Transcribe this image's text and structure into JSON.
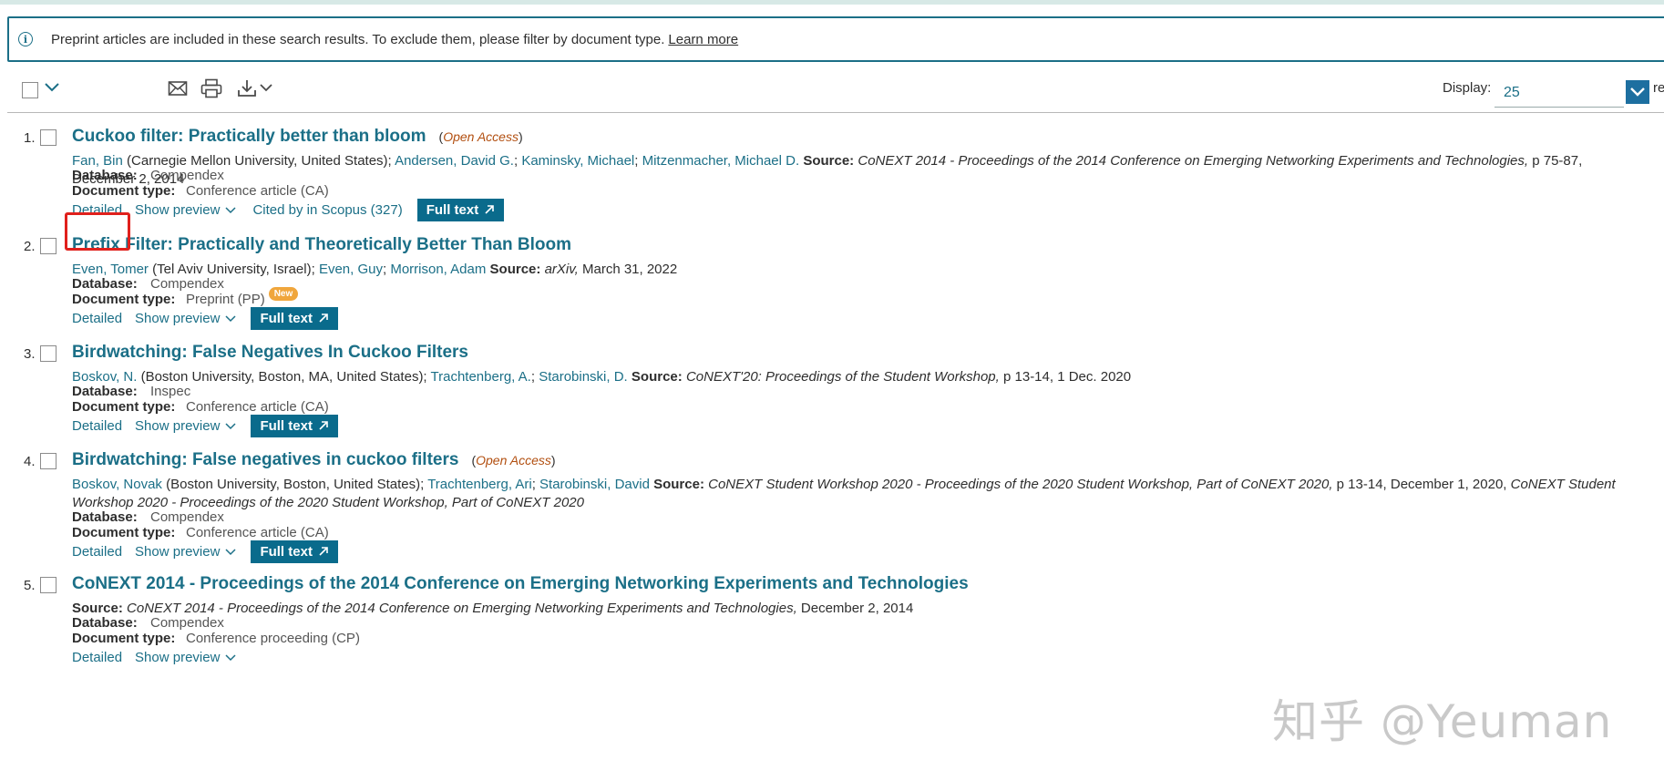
{
  "banner": {
    "message": "Preprint articles are included in these search results. To exclude them, please filter by document type.",
    "learn_more": "Learn more"
  },
  "toolbar": {
    "display_label": "Display:",
    "display_value": "25",
    "display_suffix": "resu"
  },
  "labels": {
    "database": "Database:",
    "document_type": "Document type:",
    "source": "Source:",
    "detailed": "Detailed",
    "show_preview": "Show preview",
    "full_text": "Full text",
    "open_access": "Open Access",
    "new": "New"
  },
  "results": [
    {
      "num": "1.",
      "title": "Cuckoo filter: Practically better than bloom",
      "open_access": true,
      "authors_html_parts": [
        {
          "t": "Fan, Bin",
          "link": true
        },
        {
          "t": " (Carnegie Mellon University, United States); ",
          "link": false
        },
        {
          "t": "Andersen, David G.",
          "link": true
        },
        {
          "t": "; ",
          "link": false
        },
        {
          "t": "Kaminsky, Michael",
          "link": true
        },
        {
          "t": "; ",
          "link": false
        },
        {
          "t": "Mitzenmacher, Michael D.",
          "link": true
        }
      ],
      "source_italic": "CoNEXT 2014 - Proceedings of the 2014 Conference on Emerging Networking Experiments and Technologies,",
      "source_rest": " p 75-87, December 2, 2014",
      "database": "Compendex",
      "document_type": "Conference article (CA)",
      "cited": "Cited by in Scopus (327)",
      "full_text": true
    },
    {
      "num": "2.",
      "title": "Prefix Filter: Practically and Theoretically Better Than Bloom",
      "open_access": false,
      "authors_html_parts": [
        {
          "t": "Even, Tomer",
          "link": true
        },
        {
          "t": " (Tel Aviv University, Israel); ",
          "link": false
        },
        {
          "t": "Even, Guy",
          "link": true
        },
        {
          "t": "; ",
          "link": false
        },
        {
          "t": "Morrison, Adam",
          "link": true
        }
      ],
      "source_italic": "arXiv,",
      "source_rest": " March 31, 2022",
      "database": "Compendex",
      "document_type": "Preprint (PP)",
      "is_new": true,
      "full_text": true
    },
    {
      "num": "3.",
      "title": "Birdwatching: False Negatives In Cuckoo Filters",
      "open_access": false,
      "authors_html_parts": [
        {
          "t": "Boskov, N.",
          "link": true
        },
        {
          "t": " (Boston University, Boston, MA, United States); ",
          "link": false
        },
        {
          "t": "Trachtenberg, A.",
          "link": true
        },
        {
          "t": "; ",
          "link": false
        },
        {
          "t": "Starobinski, D.",
          "link": true
        }
      ],
      "source_italic": "CoNEXT'20: Proceedings of the Student Workshop,",
      "source_rest": " p 13-14, 1 Dec. 2020",
      "database": "Inspec",
      "document_type": "Conference article (CA)",
      "full_text": true
    },
    {
      "num": "4.",
      "title": "Birdwatching: False negatives in cuckoo filters",
      "open_access": true,
      "authors_html_parts": [
        {
          "t": "Boskov, Novak",
          "link": true
        },
        {
          "t": " (Boston University, Boston, United States); ",
          "link": false
        },
        {
          "t": "Trachtenberg, Ari",
          "link": true
        },
        {
          "t": "; ",
          "link": false
        },
        {
          "t": "Starobinski, David",
          "link": true
        }
      ],
      "source_italic": "CoNEXT Student Workshop 2020 - Proceedings of the 2020 Student Workshop, Part of CoNEXT 2020,",
      "source_rest": " p 13-14, December 1, 2020, ",
      "source_italic2": "CoNEXT Student Workshop 2020 - Proceedings of the 2020 Student Workshop, Part of CoNEXT 2020",
      "database": "Compendex",
      "document_type": "Conference article (CA)",
      "full_text": true
    },
    {
      "num": "5.",
      "title": "CoNEXT 2014 - Proceedings of the 2014 Conference on Emerging Networking Experiments and Technologies",
      "open_access": false,
      "source_italic": "CoNEXT 2014 - Proceedings of the 2014 Conference on Emerging Networking Experiments and Technologies,",
      "source_rest": " December 2, 2014",
      "database": "Compendex",
      "document_type": "Conference proceeding (CP)",
      "full_text": false
    }
  ],
  "watermark": "知乎 @Yeuman"
}
